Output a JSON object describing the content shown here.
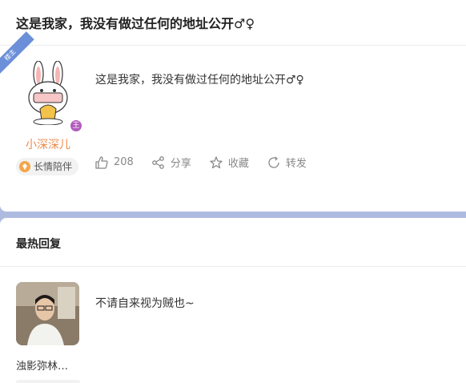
{
  "post": {
    "title": "这是我家，我没有做过任何的地址公开♂♀",
    "corner_label": "楼主",
    "body": "这是我家，我没有做过任何的地址公开♂♀",
    "author": {
      "name": "小深深儿",
      "badge_glyph": "王",
      "tag_label": "长情陪伴",
      "avatar_icon": "bunny-avatar-icon"
    },
    "actions": {
      "like_count": "208",
      "share_label": "分享",
      "favorite_label": "收藏",
      "forward_label": "转发"
    }
  },
  "hot_replies": {
    "heading": "最热回复",
    "items": [
      {
        "author": "浊影弥林…",
        "body": "不请自来视为贼也~"
      }
    ]
  },
  "colors": {
    "accent_orange": "#f08a4b",
    "band_blue": "#aebbe0",
    "corner_blue": "#6b8fd8",
    "badge_purple": "#b25bbd"
  }
}
